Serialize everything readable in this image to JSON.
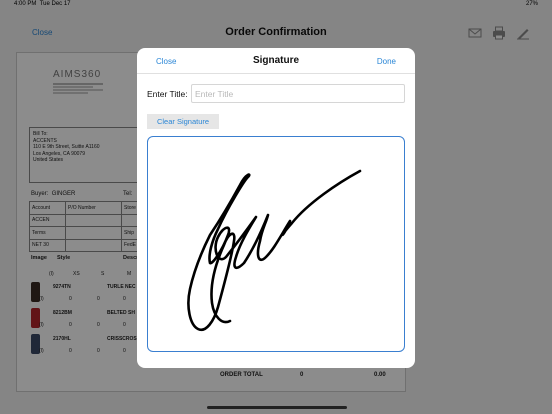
{
  "status_bar": {
    "time": "4:00 PM",
    "date": "Tue Dec 17",
    "right": "27%"
  },
  "nav": {
    "close_label": "Close",
    "title": "Order Confirmation"
  },
  "document": {
    "logo": "AIMS360",
    "bill_to": {
      "heading": "Bill To:",
      "name": "ACCENTS",
      "address_line1": "110 E 9th Street, Suitte A1160",
      "address_line2": "Los Angeles, CA 90079",
      "country": "United States"
    },
    "buyer_label": "Buyer:",
    "buyer_name": "GINGER",
    "tel_label": "Tel:",
    "account_rows": [
      {
        "col1": "Account",
        "col2": "P/O Number",
        "col3": "Store"
      },
      {
        "col1": "ACCEN",
        "col2": "",
        "col3": ""
      },
      {
        "col1": "Terms",
        "col2": "",
        "col3": "Ship"
      },
      {
        "col1": "NET 30",
        "col2": "",
        "col3": "FedE"
      }
    ],
    "columns": {
      "image": "Image",
      "style": "Style",
      "description": "Description"
    },
    "sizes": [
      "(I)",
      "XS",
      "S",
      "M"
    ],
    "items": [
      {
        "code": "9274TN",
        "description": "TURLE NEC",
        "qty": [
          "(I)",
          "0",
          "0",
          "0"
        ],
        "color": "#3a2a24"
      },
      {
        "code": "8212BM",
        "description": "BELTED SH",
        "qty": [
          "(I)",
          "0",
          "0",
          "0"
        ],
        "color": "#b3262a"
      },
      {
        "code": "2170HL",
        "description": "CRISSCROS",
        "qty": [
          "(I)",
          "0",
          "0",
          "0"
        ],
        "color": "#3b4a66"
      }
    ],
    "order_total_label": "ORDER TOTAL",
    "order_total_qty": "0",
    "order_total_amount": "0.00"
  },
  "modal": {
    "close_label": "Close",
    "title": "Signature",
    "done_label": "Done",
    "title_field_label": "Enter Title:",
    "title_field_placeholder": "Enter Title",
    "title_field_value": "",
    "clear_button_label": "Clear Signature"
  },
  "colors": {
    "accent": "#2a86d6",
    "pad_border": "#3a7fd0"
  }
}
